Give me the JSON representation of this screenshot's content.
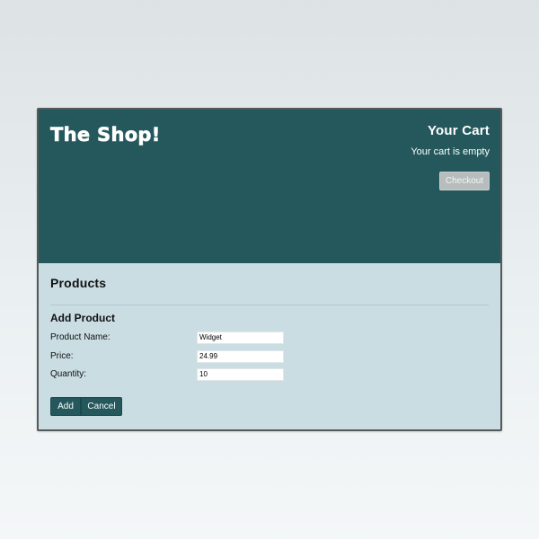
{
  "header": {
    "shop_title": "The Shop!",
    "cart": {
      "title": "Your Cart",
      "status": "Your cart is empty",
      "checkout_label": "Checkout"
    }
  },
  "products": {
    "title": "Products",
    "add_form": {
      "title": "Add Product",
      "fields": {
        "name": {
          "label": "Product Name:",
          "value": "Widget"
        },
        "price": {
          "label": "Price:",
          "value": "24.99"
        },
        "quantity": {
          "label": "Quantity:",
          "value": "10"
        }
      },
      "add_label": "Add",
      "cancel_label": "Cancel"
    }
  },
  "colors": {
    "header_bg": "#24585c",
    "main_bg": "#c9dde3",
    "checkout_disabled": "#b7bcbc"
  }
}
